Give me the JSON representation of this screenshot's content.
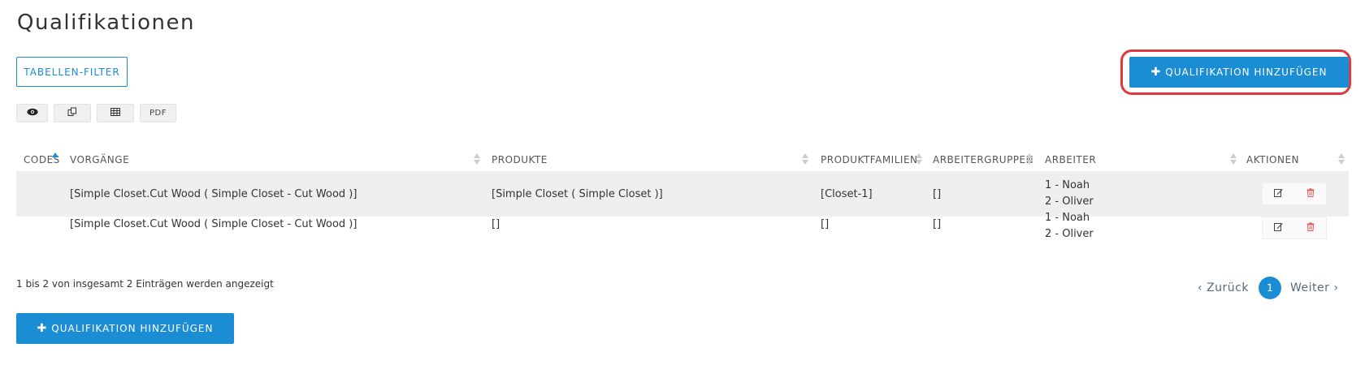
{
  "page": {
    "title": "Qualifikationen"
  },
  "toolbar": {
    "filter_label": "TABELLEN-FILTER",
    "add_label": "QUALIFIKATION HINZUFÜGEN",
    "export": [
      {
        "icon": "eye-icon"
      },
      {
        "icon": "copy-icon"
      },
      {
        "icon": "table-icon"
      },
      {
        "label": "PDF"
      }
    ]
  },
  "table": {
    "columns": [
      "CODES",
      "VORGÄNGE",
      "PRODUKTE",
      "PRODUKTFAMILIEN",
      "ARBEITERGRUPPEN",
      "ARBEITER",
      "AKTIONEN"
    ],
    "rows": [
      {
        "codes": "",
        "vorgaenge": "[Simple Closet.Cut Wood ( Simple Closet - Cut Wood )]",
        "produkte": "[Simple Closet ( Simple Closet )]",
        "produktfamilien": "[Closet-1]",
        "arbeitergruppen": "[]",
        "arbeiter": [
          "1 - Noah",
          "2 - Oliver"
        ]
      },
      {
        "codes": "",
        "vorgaenge": "[Simple Closet.Cut Wood ( Simple Closet - Cut Wood )]",
        "produkte": "[]",
        "produktfamilien": "[]",
        "arbeitergruppen": "[]",
        "arbeiter": [
          "1 - Noah",
          "2 - Oliver"
        ]
      }
    ]
  },
  "footer": {
    "info": "1 bis 2 von insgesamt 2 Einträgen werden angezeigt",
    "prev_label": "‹ Zurück",
    "current_page": "1",
    "next_label": "Weiter ›",
    "add_label": "QUALIFIKATION HINZUFÜGEN"
  },
  "colors": {
    "accent": "#1a8dd4",
    "highlight": "#e0393e",
    "delete": "#e05a5a"
  }
}
